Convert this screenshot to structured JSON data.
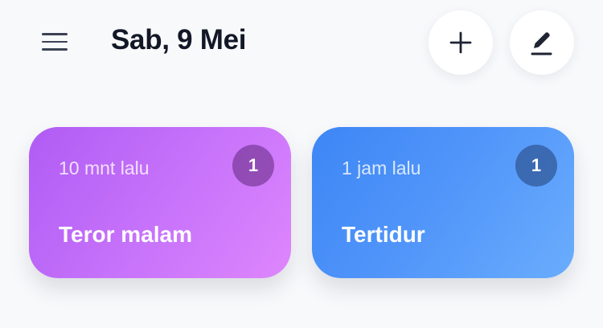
{
  "header": {
    "date": "Sab, 9 Mei",
    "menu_icon": "hamburger-menu-icon",
    "add_icon": "plus-icon",
    "edit_icon": "pencil-edit-icon"
  },
  "cards": [
    {
      "time": "10 mnt lalu",
      "count": "1",
      "title": "Teror malam",
      "color": "#b863f6"
    },
    {
      "time": "1 jam lalu",
      "count": "1",
      "title": "Tertidur",
      "color": "#4a8ef7"
    }
  ],
  "colors": {
    "background": "#f8f9fb",
    "text_dark": "#121826"
  }
}
